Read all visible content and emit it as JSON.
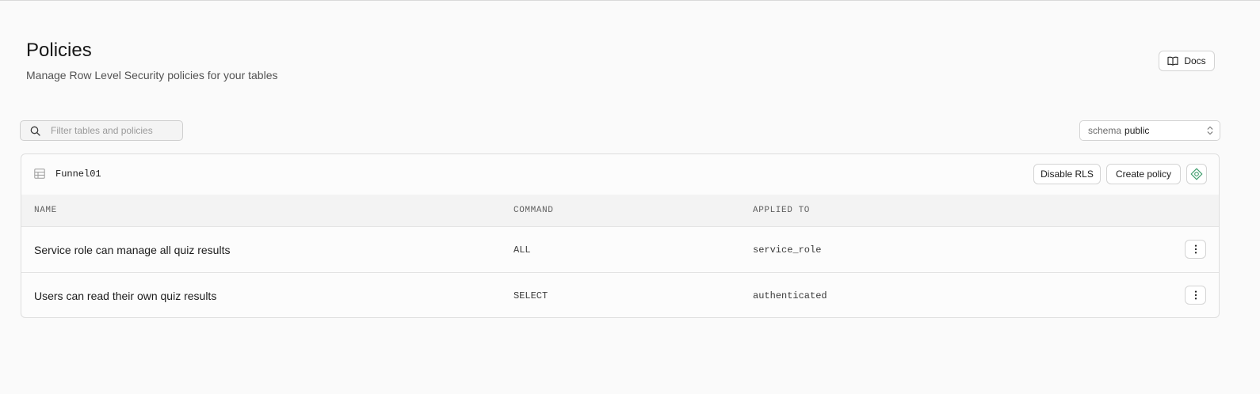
{
  "header": {
    "title": "Policies",
    "subtitle": "Manage Row Level Security policies for your tables",
    "docs_label": "Docs"
  },
  "filter": {
    "placeholder": "Filter tables and policies",
    "value": ""
  },
  "schema_select": {
    "label": "schema",
    "value": "public"
  },
  "table": {
    "name": "Funnel01",
    "disable_rls_label": "Disable RLS",
    "create_policy_label": "Create policy",
    "columns": [
      "NAME",
      "COMMAND",
      "APPLIED TO"
    ],
    "policies": [
      {
        "name": "Service role can manage all quiz results",
        "command": "ALL",
        "applied_to": "service_role"
      },
      {
        "name": "Users can read their own quiz results",
        "command": "SELECT",
        "applied_to": "authenticated"
      }
    ]
  },
  "icons": {
    "docs": "book-open-icon",
    "search": "search-icon",
    "schema_chevron": "chevrons-up-down-icon",
    "table": "table-grid-icon",
    "rls": "rls-shield-diamond-icon",
    "row_menu": "more-vertical-icon"
  },
  "colors": {
    "background": "#fafafa",
    "card_border": "#dedede",
    "rls_icon": "#3e9d6c"
  }
}
